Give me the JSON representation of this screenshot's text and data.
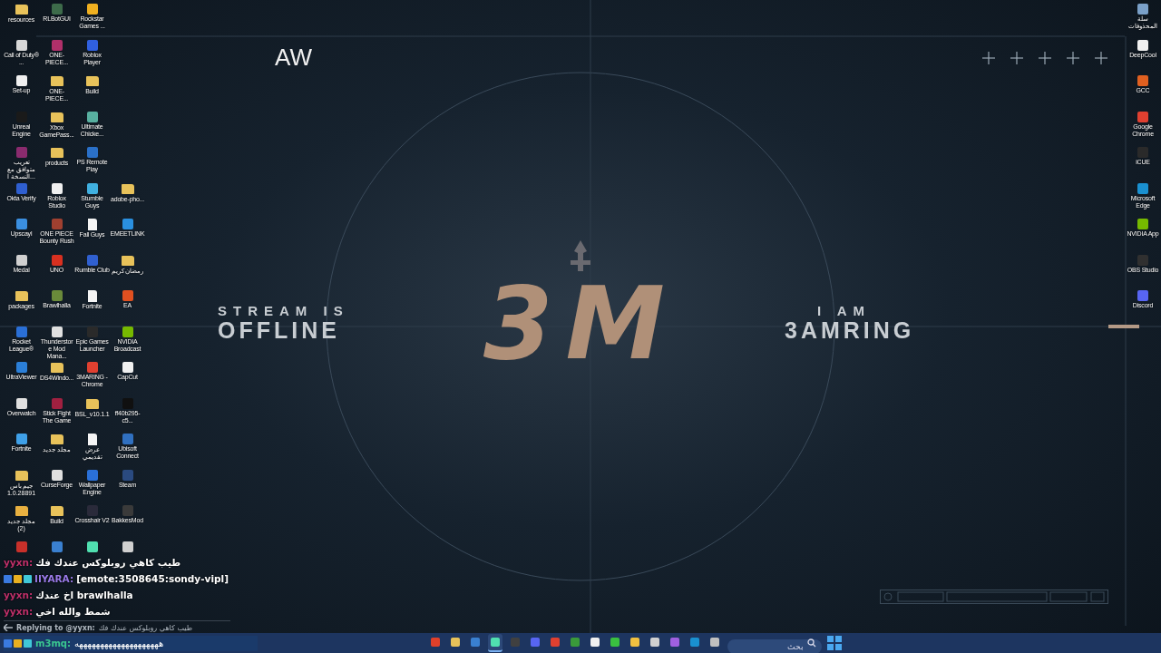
{
  "wallpaper": {
    "corner_text": "AW",
    "left_text": [
      "STREAM IS",
      "OFFLINE"
    ],
    "logo": "3M",
    "right_text": [
      "I AM",
      "3AMRING"
    ]
  },
  "desktop_left": [
    {
      "items": [
        {
          "label": "resources",
          "kind": "folder",
          "color": "#e8c25a"
        },
        {
          "label": "Call of Duty® ...",
          "kind": "app",
          "color": "#d8d8d8"
        },
        {
          "label": "Set-up",
          "kind": "app",
          "color": "#f0f0f0"
        },
        {
          "label": "Unreal Engine",
          "kind": "app",
          "color": "#1a1a1a"
        },
        {
          "label": "تعريب متوافق مع النسخة ا...",
          "kind": "app",
          "color": "#8a2b6e"
        },
        {
          "label": "Okta Verify",
          "kind": "app",
          "color": "#2f5fd0"
        },
        {
          "label": "Upscayl",
          "kind": "app",
          "color": "#3b8fe0"
        },
        {
          "label": "Medal",
          "kind": "app",
          "color": "#d0d0d0"
        },
        {
          "label": "packages",
          "kind": "folder",
          "color": "#e8c25a"
        },
        {
          "label": "Rocket League®",
          "kind": "app",
          "color": "#2a6fd6"
        },
        {
          "label": "UltraViewer",
          "kind": "app",
          "color": "#2b7fd8"
        },
        {
          "label": "Overwatch",
          "kind": "app",
          "color": "#e0e0e0"
        },
        {
          "label": "Fortnite",
          "kind": "app",
          "color": "#3fa0e8"
        },
        {
          "label": "جيم باس 1.0.28891",
          "kind": "folder",
          "color": "#e8c25a"
        },
        {
          "label": "مجلد جديد (2)",
          "kind": "folder",
          "color": "#e8b040"
        },
        {
          "kind": "app",
          "color": "#c8302a"
        }
      ]
    },
    {
      "items": [
        {
          "label": "RLBotGUI",
          "kind": "app",
          "color": "#3d6b4a"
        },
        {
          "label": "ONE-PIECE...",
          "kind": "app",
          "color": "#b0306a"
        },
        {
          "label": "ONE-PIECE...",
          "kind": "folder",
          "color": "#e8c25a"
        },
        {
          "label": "Xbox GamePass...",
          "kind": "folder",
          "color": "#e8c25a"
        },
        {
          "label": "products",
          "kind": "folder",
          "color": "#e8c25a"
        },
        {
          "label": "Roblox Studio",
          "kind": "app",
          "color": "#f0f0f0"
        },
        {
          "label": "ONE PIECE Bounty Rush",
          "kind": "app",
          "color": "#a04030"
        },
        {
          "label": "UNO",
          "kind": "app",
          "color": "#d83020"
        },
        {
          "label": "Brawlhalla",
          "kind": "app",
          "color": "#6a8a3a"
        },
        {
          "label": "Thunderstore Mod Mana...",
          "kind": "app",
          "color": "#e0e0e0"
        },
        {
          "label": "DS4Windo...",
          "kind": "folder",
          "color": "#e8c25a"
        },
        {
          "label": "Stick Fight The Game",
          "kind": "app",
          "color": "#a02040"
        },
        {
          "label": "مجلد جديد",
          "kind": "folder",
          "color": "#e8c25a"
        },
        {
          "label": "CurseForge",
          "kind": "app",
          "color": "#e0e0e0"
        },
        {
          "label": "Build",
          "kind": "folder",
          "color": "#e8c25a"
        },
        {
          "kind": "app",
          "color": "#3a80d0"
        }
      ]
    },
    {
      "items": [
        {
          "label": "Rockstar Games ...",
          "kind": "app",
          "color": "#f0b020"
        },
        {
          "label": "Roblox Player",
          "kind": "app",
          "color": "#3060e0"
        },
        {
          "label": "Build",
          "kind": "folder",
          "color": "#e8c25a"
        },
        {
          "label": "Ultimate Chicke...",
          "kind": "app",
          "color": "#58b0a0"
        },
        {
          "label": "PS Remote Play",
          "kind": "app",
          "color": "#2a70c8"
        },
        {
          "label": "Stumble Guys",
          "kind": "app",
          "color": "#40b0e0"
        },
        {
          "label": "Fall Guys",
          "kind": "file",
          "color": "#f4f4f4"
        },
        {
          "label": "Rumble Club",
          "kind": "app",
          "color": "#3060d0"
        },
        {
          "label": "Fortnite",
          "kind": "file",
          "color": "#f4f4f4"
        },
        {
          "label": "Epic Games Launcher",
          "kind": "app",
          "color": "#2a2a2a"
        },
        {
          "label": "3MARING - Chrome",
          "kind": "app",
          "color": "#e04030"
        },
        {
          "label": "BSL_v10.1.1",
          "kind": "folder",
          "color": "#e8c25a"
        },
        {
          "label": "عرض تقديمي",
          "kind": "file",
          "color": "#f4f4f4"
        },
        {
          "label": "Wallpaper Engine",
          "kind": "app",
          "color": "#2a70d8"
        },
        {
          "label": "Crosshair V2",
          "kind": "app",
          "color": "#2a2a3a"
        },
        {
          "kind": "app",
          "color": "#50e0b0"
        }
      ]
    },
    {
      "items": [
        {
          "label": "adobe-pho...",
          "kind": "folder",
          "color": "#e8c25a"
        },
        {
          "label": "EMEETLINK",
          "kind": "app",
          "color": "#2a90e0"
        },
        {
          "label": "رمضان كريم",
          "kind": "folder",
          "color": "#e8c25a"
        },
        {
          "label": "EA",
          "kind": "app",
          "color": "#e05020"
        },
        {
          "label": "NVIDIA Broadcast",
          "kind": "app",
          "color": "#76b900"
        },
        {
          "label": "CapCut",
          "kind": "app",
          "color": "#f0f0f0"
        },
        {
          "label": "ff40b295-c5...",
          "kind": "app",
          "color": "#101010"
        },
        {
          "label": "Ubisoft Connect",
          "kind": "app",
          "color": "#3070c0"
        },
        {
          "label": "Steam",
          "kind": "app",
          "color": "#2a4a80"
        },
        {
          "label": "BakkesMod",
          "kind": "app",
          "color": "#3a3a3a"
        },
        {
          "kind": "app",
          "color": "#d0d0d0"
        }
      ]
    }
  ],
  "desktop_right": [
    {
      "label": "سلة المحذوفات",
      "kind": "app",
      "color": "#7aa0c8"
    },
    {
      "label": "DeepCool",
      "kind": "app",
      "color": "#f0f0f0"
    },
    {
      "label": "GCC",
      "kind": "app",
      "color": "#e06020"
    },
    {
      "label": "Google Chrome",
      "kind": "app",
      "color": "#e04030"
    },
    {
      "label": "iCUE",
      "kind": "app",
      "color": "#2a2a2a"
    },
    {
      "label": "Microsoft Edge",
      "kind": "app",
      "color": "#1a90d0"
    },
    {
      "label": "NVIDIA App",
      "kind": "app",
      "color": "#76b900"
    },
    {
      "label": "OBS Studio",
      "kind": "app",
      "color": "#303030"
    },
    {
      "label": "Discord",
      "kind": "app",
      "color": "#5865f2"
    }
  ],
  "chat": {
    "messages": [
      {
        "user": "yyxn:",
        "color": "#c0306a",
        "badges": false,
        "text": "طيب كاهي روبلوكس عندك فك"
      },
      {
        "user": "IIYARA:",
        "color": "#9a7ae8",
        "badges": true,
        "text": "[emote:3508645:sondy-vipl]"
      },
      {
        "user": "yyxn:",
        "color": "#c0306a",
        "badges": false,
        "text": "اخ عندك **brawlhalla**"
      },
      {
        "user": "yyxn:",
        "color": "#c0306a",
        "badges": false,
        "text": "شمط والله اخي"
      }
    ],
    "reply": {
      "label": "Replying to @yyxn:",
      "text": "طيب كاهي روبلوكس عندك فك"
    },
    "input": {
      "user": "m3mq:",
      "color": "#3ac890",
      "badges": true,
      "value": "ههههههههههههههههههههه"
    }
  },
  "taskbar": {
    "apps": [
      {
        "color": "#e0402a",
        "selected": false
      },
      {
        "color": "#e8c25a",
        "selected": false
      },
      {
        "color": "#3a80d0",
        "selected": false
      },
      {
        "color": "#50e0b0",
        "selected": true
      },
      {
        "color": "#404040",
        "selected": false
      },
      {
        "color": "#5865f2",
        "selected": false
      },
      {
        "color": "#e04030",
        "selected": false
      },
      {
        "color": "#3a9a3a",
        "selected": false
      },
      {
        "color": "#f0f0f0",
        "selected": false
      },
      {
        "color": "#3ac040",
        "selected": false
      },
      {
        "color": "#f0c040",
        "selected": false
      },
      {
        "color": "#d0d0d0",
        "selected": false
      },
      {
        "color": "#a060e0",
        "selected": false
      },
      {
        "color": "#1a90d0",
        "selected": false
      },
      {
        "color": "#c0c0c0",
        "selected": false
      }
    ],
    "search": {
      "placeholder": "بحث"
    }
  }
}
